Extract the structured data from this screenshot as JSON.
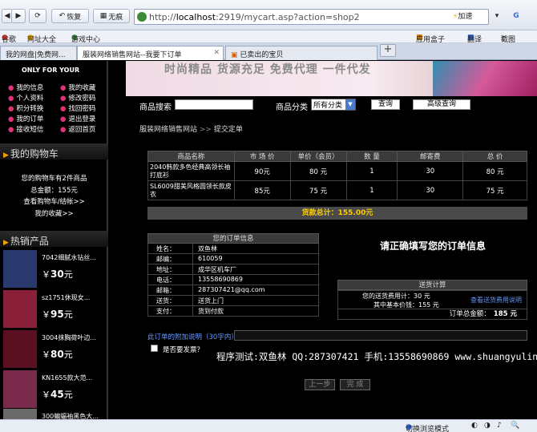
{
  "browser": {
    "nav": {
      "back": "◀",
      "forward": "▶",
      "refresh": "⟳",
      "restore": "恢复",
      "no_ad": "无痕"
    },
    "address": {
      "prefix": "http://",
      "host": "localhost",
      "rest": ":2919/mycart.asp?action=shop2"
    },
    "accelerate": "加速",
    "favorites": [
      "谷歌",
      "网址大全",
      "游戏中心"
    ],
    "fav_right": [
      "应用盒子",
      "翻译",
      "截图"
    ],
    "tabs": [
      {
        "label": "我的网盘|免费网...",
        "active": false
      },
      {
        "label": "服装网络销售网站--我要下订单",
        "active": true
      },
      {
        "label": "已卖出的宝贝",
        "active": false
      }
    ],
    "status_mode": "切换浏览模式"
  },
  "sidebar": {
    "only_for_you": "ONLY FOR YOUR",
    "member_links": [
      [
        "我的信息",
        "我的收藏"
      ],
      [
        "个人资料",
        "修改密码"
      ],
      [
        "积分转换",
        "找回密码"
      ],
      [
        "我的订单",
        "退出登录"
      ],
      [
        "接收短信",
        "返回首页"
      ]
    ],
    "cart_title": "我的购物车",
    "cart_count": "您的购物车有2件商品",
    "cart_total": "总金额：155元",
    "cart_view": "查看购物车/结帐>>",
    "my_fav": "我的收藏>>",
    "hot_title": "热销产品",
    "hot_items": [
      {
        "name": "7042细腻水钻丝...",
        "price": "30",
        "color": "#2b3a6e"
      },
      {
        "name": "sz1751休现女...",
        "price": "95",
        "color": "#8a1f3a"
      },
      {
        "name": "3004抹胸荷叶边...",
        "price": "80",
        "color": "#5a1020"
      },
      {
        "name": "KN1655款大范...",
        "price": "45",
        "color": "#7a2a4a"
      },
      {
        "name": "300蝙蝠袖黑色大...",
        "price": "",
        "color": "#6a6a6a"
      }
    ],
    "currency": "￥",
    "yuan": "元"
  },
  "banner": {
    "slogan": "时尚精品  货源充足  免费代理  一件代发"
  },
  "search": {
    "label": "商品搜索",
    "cat_label": "商品分类",
    "cat_value": "所有分类",
    "search_btn": "查询",
    "adv_btn": "高级查询"
  },
  "breadcrumb": {
    "home": "服装网络销售网站",
    "sep": ">>",
    "current": "提交定单"
  },
  "cart": {
    "headers": [
      "商品名称",
      "市 场 价",
      "单价（会员）",
      "数 量",
      "邮寄费",
      "总 价"
    ],
    "rows": [
      [
        "2040韩款多色经典高领长袖打底衫",
        "90元",
        "80 元",
        "1",
        "30",
        "80 元"
      ],
      [
        "SL6009甜美风格圆领长款皮衣",
        "85元",
        "75 元",
        "1",
        "30",
        "75 元"
      ]
    ],
    "total": "货款总计：155.00元"
  },
  "order_info": {
    "title": "您的订单信息",
    "rows": [
      [
        "姓名：",
        "双鱼林"
      ],
      [
        "邮编：",
        "610059"
      ],
      [
        "地址：",
        "成华区机车厂"
      ],
      [
        "电话：",
        "13558690869"
      ],
      [
        "邮箱：",
        "287307421@qq.com"
      ],
      [
        "送货：",
        "送货上门"
      ],
      [
        "支付：",
        "货到付款"
      ]
    ]
  },
  "confirm_text": "请正确填写您的订单信息",
  "shipping": {
    "title": "送货计算",
    "fee_line": "您的送货费用计：30 元",
    "base_line": "其中基本价钱：155 元",
    "link": "查看送货费用说明",
    "order_total_label": "订单总金额：",
    "order_total": "185 元"
  },
  "notes": {
    "label": "此订单的附加说明（30字内）",
    "invoice": "是否要发票？"
  },
  "tester": "程序测试:双鱼林 QQ:287307421 手机:13558690869 www.shuangyulin.com",
  "buttons": {
    "prev": "上一步",
    "finish": "完 成"
  }
}
